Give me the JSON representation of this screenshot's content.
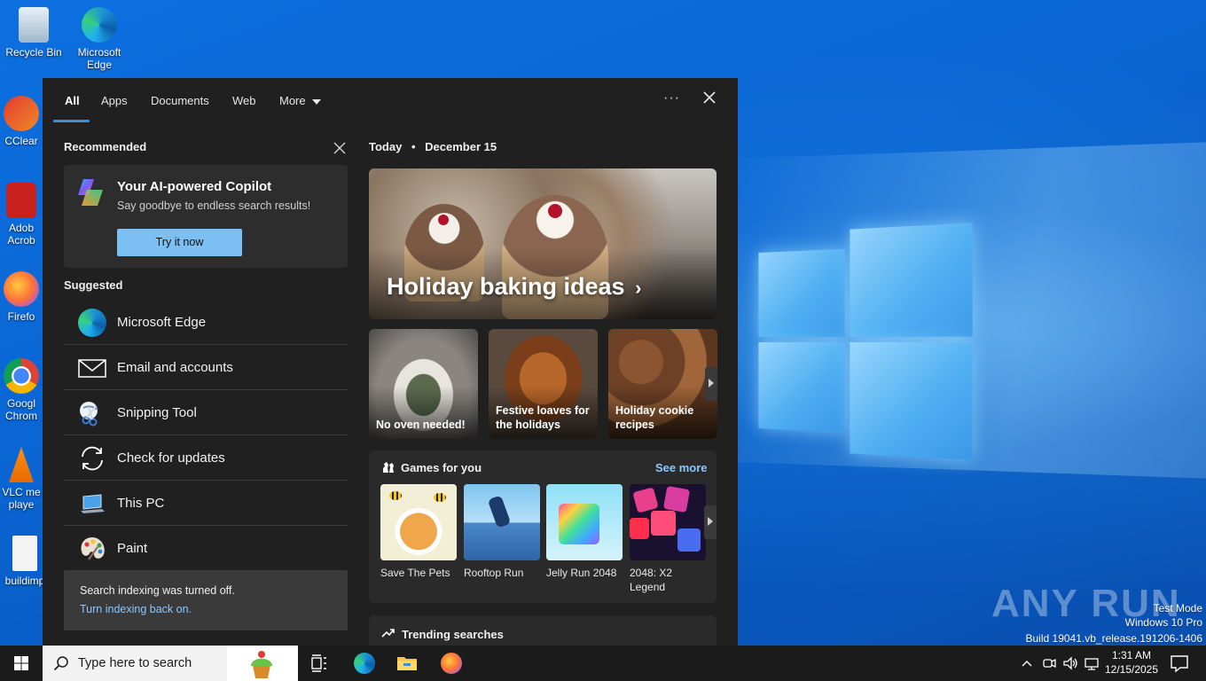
{
  "desktop": {
    "icons": [
      {
        "label": "Recycle Bin"
      },
      {
        "label": "Microsoft Edge"
      },
      {
        "label": "CClear"
      },
      {
        "label": "Adob Acrob"
      },
      {
        "label": "Firefo"
      },
      {
        "label": "Googl Chrom"
      },
      {
        "label": "VLC me playe"
      },
      {
        "label": "buildimp"
      }
    ],
    "watermark": {
      "brand": "ANY RUN",
      "line1": "Test Mode",
      "line2": "Windows 10 Pro",
      "line3": "Build 19041.vb_release.191206-1406"
    }
  },
  "search_panel": {
    "tabs": [
      {
        "label": "All",
        "active": true
      },
      {
        "label": "Apps"
      },
      {
        "label": "Documents"
      },
      {
        "label": "Web"
      },
      {
        "label": "More"
      }
    ],
    "options_icon": "more-options-icon",
    "close_icon": "close-icon",
    "recommended": {
      "heading": "Recommended",
      "card_title": "Your AI-powered Copilot",
      "card_subtitle": "Say goodbye to endless search results!",
      "button_label": "Try it now"
    },
    "suggested": {
      "heading": "Suggested",
      "items": [
        {
          "label": "Microsoft Edge",
          "icon": "edge-icon"
        },
        {
          "label": "Email and accounts",
          "icon": "mail-icon"
        },
        {
          "label": "Snipping Tool",
          "icon": "scissors-icon"
        },
        {
          "label": "Check for updates",
          "icon": "sync-icon"
        },
        {
          "label": "This PC",
          "icon": "laptop-icon"
        },
        {
          "label": "Paint",
          "icon": "palette-icon"
        }
      ]
    },
    "indexing": {
      "message": "Search indexing was turned off.",
      "link": "Turn indexing back on."
    },
    "today": {
      "label": "Today",
      "separator": "•",
      "date": "December 15",
      "hero_title": "Holiday baking ideas",
      "tiles": [
        {
          "label": "No oven needed!"
        },
        {
          "label": "Festive loaves for the holidays"
        },
        {
          "label": "Holiday cookie recipes"
        }
      ]
    },
    "games": {
      "heading": "Games for you",
      "see_more": "See more",
      "items": [
        {
          "label": "Save The Pets"
        },
        {
          "label": "Rooftop Run"
        },
        {
          "label": "Jelly Run 2048"
        },
        {
          "label": "2048: X2 Legend"
        }
      ]
    },
    "trending": {
      "heading": "Trending searches"
    }
  },
  "taskbar": {
    "search_placeholder": "Type here to search",
    "time": "1:31 AM",
    "date": "12/15/2025"
  }
}
